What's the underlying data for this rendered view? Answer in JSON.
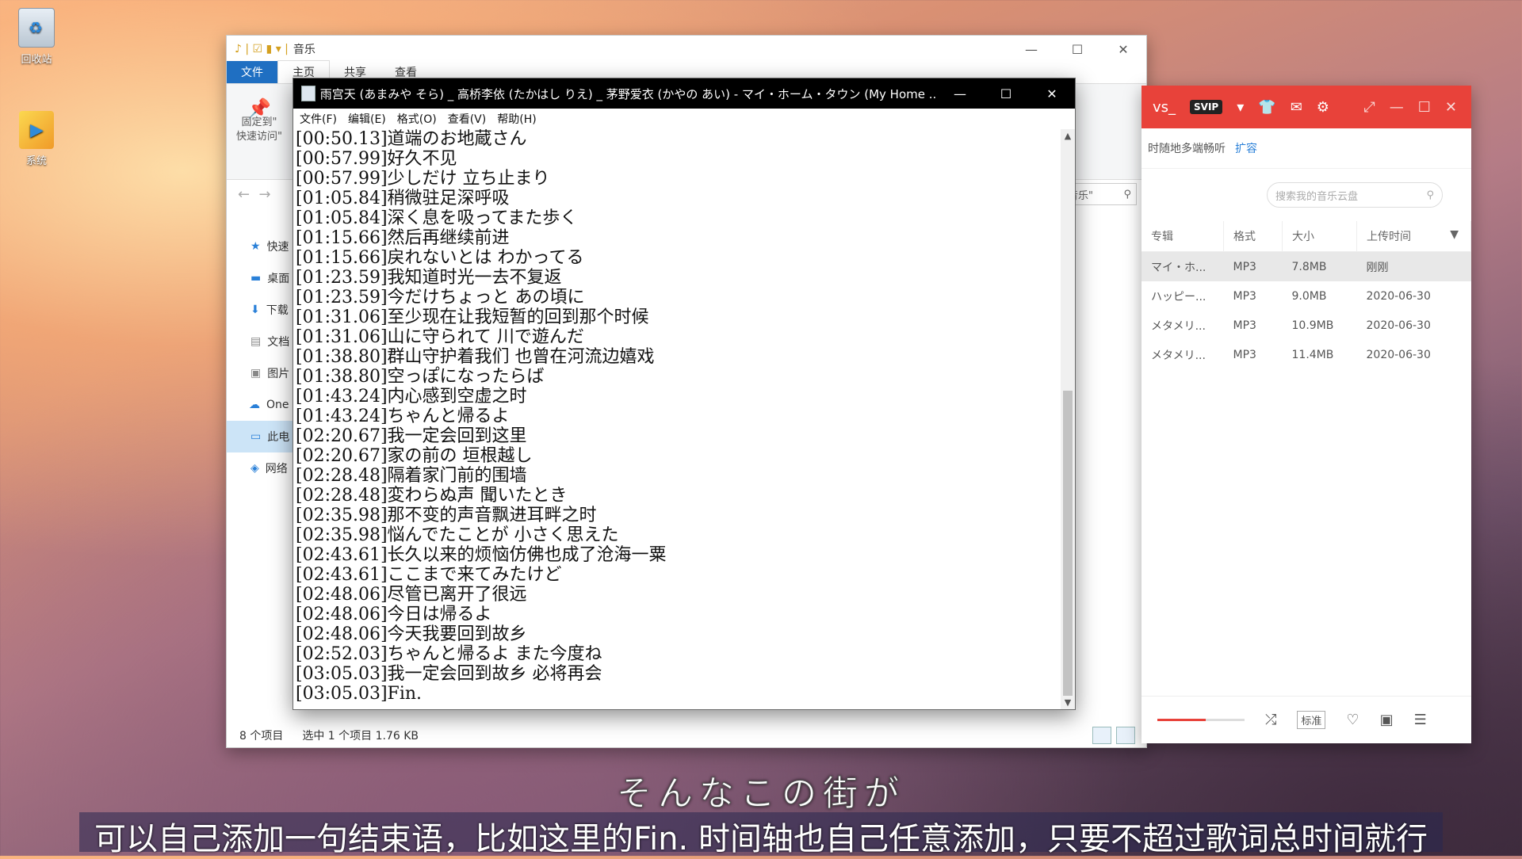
{
  "desktop": {
    "icons": [
      {
        "label": "回收站",
        "icon": "recycle-bin-icon"
      },
      {
        "label": "系统",
        "icon": "app-shortcut-icon"
      }
    ]
  },
  "explorer": {
    "title": "音乐",
    "tabs": [
      "文件",
      "主页",
      "共享",
      "查看"
    ],
    "pin_label_1": "固定到\"",
    "pin_label_2": "快速访问\"",
    "search_text": "音乐\"",
    "sidebar": [
      "快速",
      "桌面",
      "下载",
      "文档",
      "图片",
      "One",
      "此电",
      "网络"
    ],
    "status_items": "8 个项目",
    "status_selected": "选中 1 个项目  1.76 KB"
  },
  "music_app": {
    "account": "vs_",
    "vip": "SVIP",
    "note": "时随地多端畅听",
    "expand_link": "扩容",
    "search_placeholder": "搜索我的音乐云盘",
    "columns": [
      "专辑",
      "格式",
      "大小",
      "上传时间"
    ],
    "rows": [
      {
        "album": "マイ・ホ...",
        "format": "MP3",
        "size": "7.8MB",
        "time": "刚刚"
      },
      {
        "album": "ハッピー...",
        "format": "MP3",
        "size": "9.0MB",
        "time": "2020-06-30"
      },
      {
        "album": "メタメリ...",
        "format": "MP3",
        "size": "10.9MB",
        "time": "2020-06-30"
      },
      {
        "album": "メタメリ...",
        "format": "MP3",
        "size": "11.4MB",
        "time": "2020-06-30"
      }
    ],
    "player": {
      "quality_label": "标准",
      "progress": 0.55
    },
    "accent": "#e8423a"
  },
  "notepad": {
    "title": "雨宫天 (あまみや そら) _ 高桥李依 (たかはし りえ) _ 茅野爱衣 (かやの あい) - マイ・ホーム・タウン (My Home ...",
    "menu": [
      "文件(F)",
      "编辑(E)",
      "格式(O)",
      "查看(V)",
      "帮助(H)"
    ],
    "lines": [
      "[00:50.13]道端のお地蔵さん",
      "[00:57.99]好久不见",
      "[00:57.99]少しだけ 立ち止まり",
      "[01:05.84]稍微驻足深呼吸",
      "[01:05.84]深く息を吸ってまた歩く",
      "[01:15.66]然后再继续前进",
      "[01:15.66]戻れないとは わかってる",
      "[01:23.59]我知道时光一去不复返",
      "[01:23.59]今だけちょっと あの頃に",
      "[01:31.06]至少现在让我短暂的回到那个时候",
      "[01:31.06]山に守られて 川で遊んだ",
      "[01:38.80]群山守护着我们 也曾在河流边嬉戏",
      "[01:38.80]空っぽになったらば",
      "[01:43.24]内心感到空虚之时",
      "[01:43.24]ちゃんと帰るよ",
      "[02:20.67]我一定会回到这里",
      "[02:20.67]家の前の 垣根越し",
      "[02:28.48]隔着家门前的围墙",
      "[02:28.48]変わらぬ声 聞いたとき",
      "[02:35.98]那不变的声音飘进耳畔之时",
      "[02:35.98]悩んでたことが 小さく思えた",
      "[02:43.61]长久以来的烦恼仿佛也成了沧海一粟",
      "[02:43.61]ここまで来てみたけど",
      "[02:48.06]尽管已离开了很远",
      "[02:48.06]今日は帰るよ",
      "[02:48.06]今天我要回到故乡",
      "[02:52.03]ちゃんと帰るよ また今度ね",
      "[03:05.03]我一定会回到故乡 必将再会",
      "[03:05.03]Fin."
    ]
  },
  "subtitles": {
    "japanese": "そんなこの街が",
    "chinese": "可以自己添加一句结束语，比如这里的Fin. 时间轴也自己任意添加，只要不超过歌词总时间就行"
  }
}
